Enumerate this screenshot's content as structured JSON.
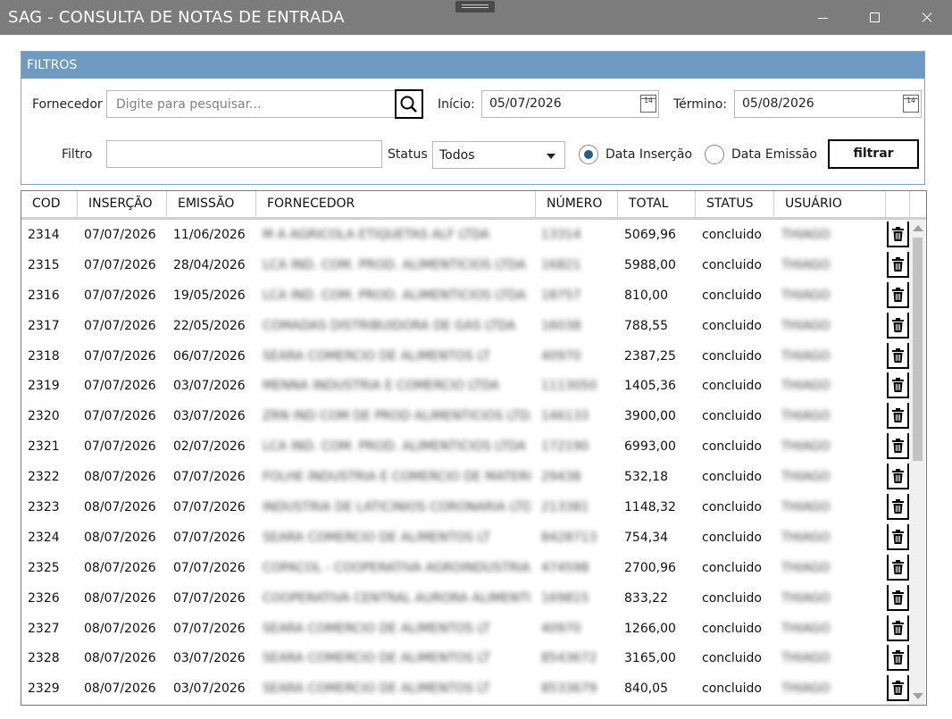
{
  "window": {
    "title": "SAG - CONSULTA DE NOTAS DE ENTRADA"
  },
  "filters": {
    "header": "FILTROS",
    "fornecedor_label": "Fornecedor",
    "fornecedor_placeholder": "Digite para pesquisar...",
    "inicio_label": "Início:",
    "inicio_value": "05/07/2026",
    "termino_label": "Término:",
    "termino_value": "05/08/2026",
    "calendar_day": "14",
    "filtro_label": "Filtro",
    "filtro_value": "",
    "status_label": "Status",
    "status_value": "Todos",
    "radio_insercao": "Data Inserção",
    "radio_emissao": "Data Emissão",
    "filtrar_label": "filtrar"
  },
  "grid": {
    "columns": [
      "COD",
      "INSERÇÃO",
      "EMISSÃO",
      "FORNECEDOR",
      "NÚMERO",
      "TOTAL",
      "STATUS",
      "USUÁRIO"
    ],
    "rows": [
      {
        "cod": "2314",
        "insercao": "07/07/2026",
        "emissao": "11/06/2026",
        "fornecedor": "M A AGRICOLA ETIQUETAS ALF LTDA",
        "numero": "13314",
        "total": "5069,96",
        "status": "concluido",
        "usuario": "THIAGO"
      },
      {
        "cod": "2315",
        "insercao": "07/07/2026",
        "emissao": "28/04/2026",
        "fornecedor": "LCA IND. COM. PROD. ALIMENTICIOS LTDA",
        "numero": "16821",
        "total": "5988,00",
        "status": "concluido",
        "usuario": "THIAGO"
      },
      {
        "cod": "2316",
        "insercao": "07/07/2026",
        "emissao": "19/05/2026",
        "fornecedor": "LCA IND. COM. PROD. ALIMENTICIOS LTDA",
        "numero": "18757",
        "total": "810,00",
        "status": "concluido",
        "usuario": "THIAGO"
      },
      {
        "cod": "2317",
        "insercao": "07/07/2026",
        "emissao": "22/05/2026",
        "fornecedor": "COMADAS DISTRIBUIDORA DE GAS LTDA",
        "numero": "16038",
        "total": "788,55",
        "status": "concluido",
        "usuario": "THIAGO"
      },
      {
        "cod": "2318",
        "insercao": "07/07/2026",
        "emissao": "06/07/2026",
        "fornecedor": "SEARA COMERCIO DE ALIMENTOS LT",
        "numero": "40970",
        "total": "2387,25",
        "status": "concluido",
        "usuario": "THIAGO"
      },
      {
        "cod": "2319",
        "insercao": "07/07/2026",
        "emissao": "03/07/2026",
        "fornecedor": "MENNA INDUSTRIA E COMERCIO LTDA",
        "numero": "1113050",
        "total": "1405,36",
        "status": "concluido",
        "usuario": "THIAGO"
      },
      {
        "cod": "2320",
        "insercao": "07/07/2026",
        "emissao": "03/07/2026",
        "fornecedor": "ZRN IND COM DE PROD ALIMENTICIOS LTDA",
        "numero": "146133",
        "total": "3900,00",
        "status": "concluido",
        "usuario": "THIAGO"
      },
      {
        "cod": "2321",
        "insercao": "07/07/2026",
        "emissao": "02/07/2026",
        "fornecedor": "LCA IND. COM. PROD. ALIMENTICIOS LTDA",
        "numero": "172190",
        "total": "6993,00",
        "status": "concluido",
        "usuario": "THIAGO"
      },
      {
        "cod": "2322",
        "insercao": "08/07/2026",
        "emissao": "07/07/2026",
        "fornecedor": "FOLHE INDUSTRIA E COMERCIO DE MATERIA",
        "numero": "29438",
        "total": "532,18",
        "status": "concluido",
        "usuario": "THIAGO"
      },
      {
        "cod": "2323",
        "insercao": "08/07/2026",
        "emissao": "07/07/2026",
        "fornecedor": "INDUSTRIA DE LATICINIOS CORONARIA LTDA",
        "numero": "213381",
        "total": "1148,32",
        "status": "concluido",
        "usuario": "THIAGO"
      },
      {
        "cod": "2324",
        "insercao": "08/07/2026",
        "emissao": "07/07/2026",
        "fornecedor": "SEARA COMERCIO DE ALIMENTOS LT",
        "numero": "8428713",
        "total": "754,34",
        "status": "concluido",
        "usuario": "THIAGO"
      },
      {
        "cod": "2325",
        "insercao": "08/07/2026",
        "emissao": "07/07/2026",
        "fornecedor": "COPACOL - COOPERATIVA AGROINDUSTRIAL",
        "numero": "474598",
        "total": "2700,96",
        "status": "concluido",
        "usuario": "THIAGO"
      },
      {
        "cod": "2326",
        "insercao": "08/07/2026",
        "emissao": "07/07/2026",
        "fornecedor": "COOPERATIVA CENTRAL AURORA ALIMENTO",
        "numero": "169815",
        "total": "833,22",
        "status": "concluido",
        "usuario": "THIAGO"
      },
      {
        "cod": "2327",
        "insercao": "08/07/2026",
        "emissao": "07/07/2026",
        "fornecedor": "SEARA COMERCIO DE ALIMENTOS LT",
        "numero": "40970",
        "total": "1266,00",
        "status": "concluido",
        "usuario": "THIAGO"
      },
      {
        "cod": "2328",
        "insercao": "08/07/2026",
        "emissao": "03/07/2026",
        "fornecedor": "SEARA COMERCIO DE ALIMENTOS LT",
        "numero": "8543672",
        "total": "3165,00",
        "status": "concluido",
        "usuario": "THIAGO"
      },
      {
        "cod": "2329",
        "insercao": "08/07/2026",
        "emissao": "03/07/2026",
        "fornecedor": "SEARA COMERCIO DE ALIMENTOS LT",
        "numero": "8533679",
        "total": "840,05",
        "status": "concluido",
        "usuario": "THIAGO"
      }
    ]
  }
}
